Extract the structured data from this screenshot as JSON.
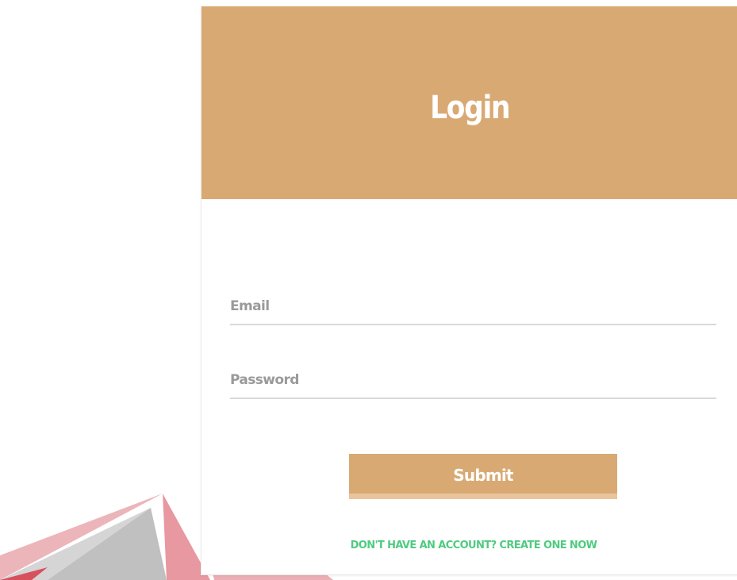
{
  "header": {
    "title": "Login",
    "color": "#d9a973"
  },
  "form": {
    "email": {
      "placeholder": "Email",
      "value": ""
    },
    "password": {
      "placeholder": "Password",
      "value": ""
    },
    "submit_label": "Submit",
    "submit_color": "#d9a973"
  },
  "footer": {
    "signup_link": "DON'T HAVE AN ACCOUNT? CREATE ONE NOW",
    "link_color": "#4fcb80"
  },
  "watermark": {
    "icon": "partial-logo-icon",
    "colors": [
      "#cf2e3d",
      "#cdcdcd"
    ]
  }
}
